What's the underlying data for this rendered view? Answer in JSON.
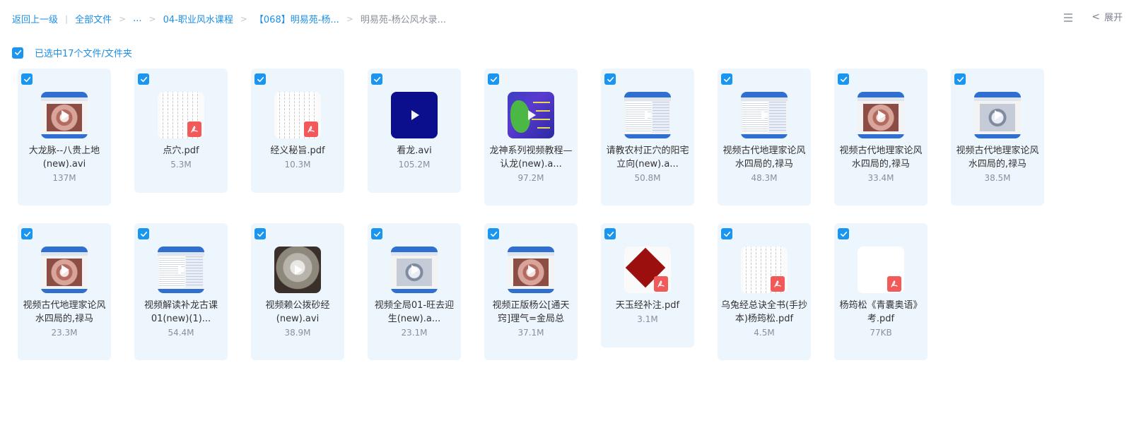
{
  "breadcrumb": {
    "back": "返回上一级",
    "all_files": "全部文件",
    "ellipsis": "...",
    "level1": "04-职业风水课程",
    "level2": "【068】明易苑-杨...",
    "current": "明易苑-杨公风水录..."
  },
  "toolbar": {
    "expand_label": "展开",
    "list_view_icon": "list-view-icon",
    "expand_icon": "chevron-left-icon"
  },
  "selection": {
    "label": "已选中17个文件/文件夹",
    "checked": true
  },
  "accent_color": "#1a96f0",
  "files": [
    {
      "name": "大龙脉--八贵上地(new).avi",
      "size": "137M",
      "thumb": "video-a",
      "type": "video"
    },
    {
      "name": "点穴.pdf",
      "size": "5.3M",
      "thumb": "doc",
      "type": "pdf"
    },
    {
      "name": "经义秘旨.pdf",
      "size": "10.3M",
      "thumb": "doc",
      "type": "pdf"
    },
    {
      "name": "看龙.avi",
      "size": "105.2M",
      "thumb": "navy",
      "type": "video"
    },
    {
      "name": "龙神系列视频教程—认龙(new).a...",
      "size": "97.2M",
      "thumb": "dragon",
      "type": "video"
    },
    {
      "name": "请教农村正穴的阳宅立向(new).a...",
      "size": "50.8M",
      "thumb": "video-b",
      "type": "video"
    },
    {
      "name": "视频古代地理家论风水四局的,禄马",
      "size": "48.3M",
      "thumb": "video-b",
      "type": "video"
    },
    {
      "name": "视频古代地理家论风水四局的,禄马",
      "size": "33.4M",
      "thumb": "video-a",
      "type": "video"
    },
    {
      "name": "视频古代地理家论风水四局的,禄马",
      "size": "38.5M",
      "thumb": "video-c",
      "type": "video"
    },
    {
      "name": "视频古代地理家论风水四局的,禄马",
      "size": "23.3M",
      "thumb": "video-a",
      "type": "video"
    },
    {
      "name": "视频解读补龙古课01(new)(1)...",
      "size": "54.4M",
      "thumb": "video-b",
      "type": "video"
    },
    {
      "name": "视频赖公拨砂经(new).avi",
      "size": "38.9M",
      "thumb": "bowl",
      "type": "video"
    },
    {
      "name": "视频全局01-旺去迎生(new).a...",
      "size": "23.1M",
      "thumb": "video-c",
      "type": "video"
    },
    {
      "name": "视频正版杨公[通天窍]理气=金局总",
      "size": "37.1M",
      "thumb": "video-a",
      "type": "video"
    },
    {
      "name": "天玉经补注.pdf",
      "size": "3.1M",
      "thumb": "red",
      "type": "pdf"
    },
    {
      "name": "乌兔经总诀全书(手抄本)杨筠松.pdf",
      "size": "4.5M",
      "thumb": "doc",
      "type": "pdf"
    },
    {
      "name": "杨筠松《青囊奥语》考.pdf",
      "size": "77KB",
      "thumb": "blank",
      "type": "pdf"
    }
  ]
}
